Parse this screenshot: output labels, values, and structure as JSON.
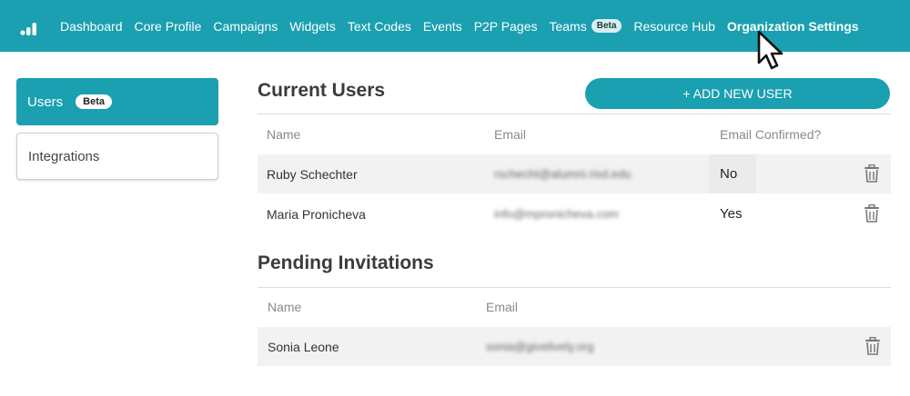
{
  "nav": {
    "items": [
      {
        "label": "Dashboard"
      },
      {
        "label": "Core Profile"
      },
      {
        "label": "Campaigns"
      },
      {
        "label": "Widgets"
      },
      {
        "label": "Text Codes"
      },
      {
        "label": "Events"
      },
      {
        "label": "P2P Pages"
      },
      {
        "label": "Teams",
        "badge": "Beta"
      },
      {
        "label": "Resource Hub"
      },
      {
        "label": "Organization Settings",
        "active": true
      }
    ]
  },
  "sidebar": {
    "users_label": "Users",
    "users_badge": "Beta",
    "integrations_label": "Integrations"
  },
  "current_users": {
    "title": "Current Users",
    "add_button": "+ ADD NEW USER",
    "headers": {
      "name": "Name",
      "email": "Email",
      "confirmed": "Email Confirmed?"
    },
    "rows": [
      {
        "name": "Ruby Schechter",
        "email": "rschecht@alumni.risd.edu",
        "confirmed": "No"
      },
      {
        "name": "Maria Pronicheva",
        "email": "info@mpronicheva.com",
        "confirmed": "Yes"
      }
    ]
  },
  "pending": {
    "title": "Pending Invitations",
    "headers": {
      "name": "Name",
      "email": "Email"
    },
    "rows": [
      {
        "name": "Sonia Leone",
        "email": "sonia@givelively.org"
      }
    ]
  },
  "colors": {
    "brand": "#1aa0b0",
    "row_shade": "#f2f2f2"
  },
  "icons": {
    "logo": "givelively-logo-icon",
    "delete": "trash-icon",
    "cursor": "mouse-pointer-icon"
  }
}
